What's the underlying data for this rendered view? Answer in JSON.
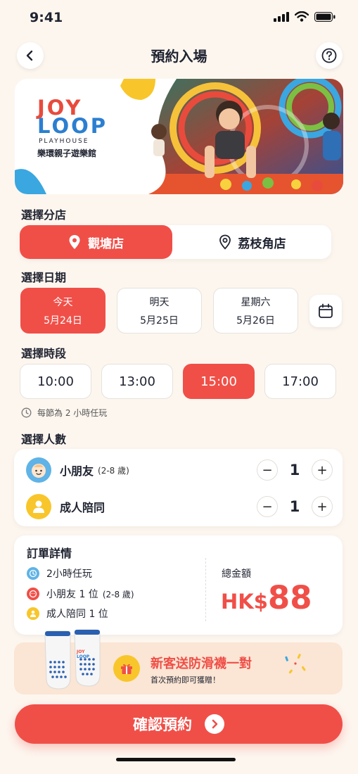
{
  "status_bar": {
    "time": "9:41"
  },
  "header": {
    "title": "預約入場"
  },
  "brand": {
    "word1": "JOY",
    "word2": "LOOP",
    "sub": "PLAYHOUSE",
    "name": "樂環親子遊樂館"
  },
  "branch": {
    "label": "選擇分店",
    "options": [
      "觀塘店",
      "荔枝角店"
    ],
    "selected": "觀塘店"
  },
  "date": {
    "label": "選擇日期",
    "options": [
      {
        "day": "今天",
        "date": "5月24日"
      },
      {
        "day": "明天",
        "date": "5月25日"
      },
      {
        "day": "星期六",
        "date": "5月26日"
      }
    ],
    "selected": "今天"
  },
  "timeslot": {
    "label": "選擇時段",
    "options": [
      "10:00",
      "13:00",
      "15:00",
      "17:00"
    ],
    "selected": "15:00",
    "note": "每節為 2 小時任玩"
  },
  "people": {
    "label": "選擇人數",
    "child_label": "小朋友",
    "child_age": "(2-8 歲)",
    "child_qty": "1",
    "adult_label": "成人陪同",
    "adult_qty": "1",
    "minus": "−",
    "plus": "+"
  },
  "order": {
    "title": "訂單詳情",
    "item1": "2小時任玩",
    "item2": "小朋友 1 位",
    "item2_age": "(2-8 歲)",
    "item3": "成人陪同 1 位",
    "total_label": "總金額",
    "currency": "HK$",
    "amount": "88"
  },
  "promo": {
    "title": "新客送防滑襪一對",
    "subtitle": "首次預約即可獲贈！",
    "sock_brand1": "JOY",
    "sock_brand2": "LOOP"
  },
  "cta": {
    "label": "確認預約"
  },
  "colors": {
    "accent": "#f04f48",
    "background": "#fdf6ef",
    "yellow": "#f8c62a",
    "blue": "#3aa7e0"
  }
}
